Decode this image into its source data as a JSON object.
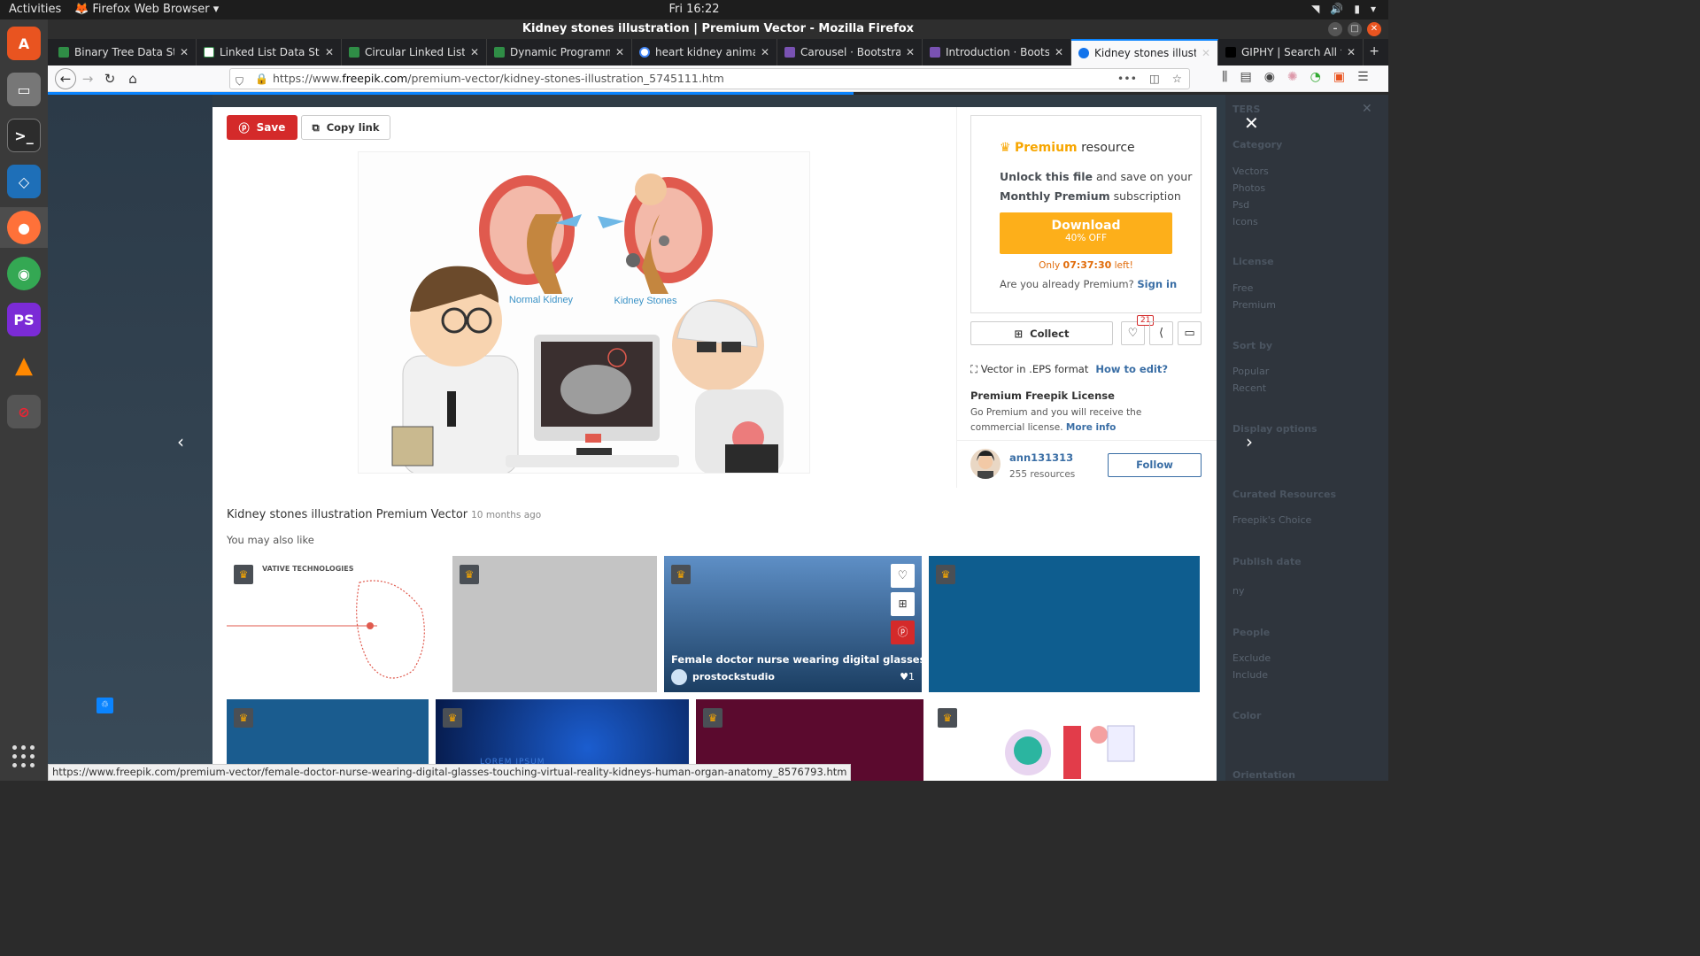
{
  "system": {
    "activities": "Activities",
    "app_menu": "Firefox Web Browser",
    "clock": "Fri 16:22"
  },
  "window": {
    "title": "Kidney stones illustration | Premium Vector - Mozilla Firefox"
  },
  "tabs": [
    {
      "label": "Binary Tree Data Stru"
    },
    {
      "label": "Linked List Data Struc"
    },
    {
      "label": "Circular Linked List | S"
    },
    {
      "label": "Dynamic Programmin"
    },
    {
      "label": "heart kidney animatio"
    },
    {
      "label": "Carousel · Bootstrap"
    },
    {
      "label": "Introduction · Bootst"
    },
    {
      "label": "Kidney stones illustra"
    },
    {
      "label": "GIPHY | Search All the"
    }
  ],
  "url": {
    "prefix": "https://www.",
    "domain": "freepik.com",
    "path": "/premium-vector/kidney-stones-illustration_5745111.htm"
  },
  "modal": {
    "save": "Save",
    "copy_link": "Copy link",
    "illustration": {
      "label_normal": "Normal Kidney",
      "label_stones": "Kidney Stones"
    },
    "premium": {
      "word": "Premium",
      "rest": " resource"
    },
    "unlock": {
      "b1": "Unlock this file",
      "t1": " and save on your ",
      "b2": "Monthly Premium",
      "t2": " subscription"
    },
    "download": {
      "label": "Download",
      "sub": "40% OFF"
    },
    "only": {
      "pre": "Only ",
      "time": "07:37:30",
      "post": " left!"
    },
    "already": {
      "text": "Are you already Premium? ",
      "link": "Sign in"
    },
    "collect": "Collect",
    "likes": "21",
    "format": {
      "text": "Vector in .EPS format",
      "link": "How to edit?"
    },
    "license": {
      "title": "Premium Freepik License",
      "text": "Go Premium and you will receive the commercial license. ",
      "link": "More info"
    },
    "author": {
      "name": "ann131313",
      "resources": "255 resources",
      "follow": "Follow"
    },
    "title": "Kidney stones illustration Premium Vector",
    "age": "10 months ago",
    "also": "You may also like",
    "related_hover": {
      "title": "Female doctor nurse wearing digital glasses touchin...",
      "author": "prostockstudio",
      "likes": "1"
    },
    "thumb1_text": "VATIVE  TECHNOLOGIES",
    "thumb6_text": "LOREM IPSUM"
  },
  "filters": {
    "header": "TERS",
    "category": "Category",
    "cat_items": [
      "Vectors",
      "Photos",
      "Psd",
      "Icons"
    ],
    "license": "License",
    "lic_items": [
      "Free",
      "Premium"
    ],
    "sort": "Sort by",
    "sort_items": [
      "Popular",
      "Recent"
    ],
    "display": "Display options",
    "curated": "Curated Resources",
    "curated_item": "Freepik's Choice",
    "publish": "Publish date",
    "publish_item": "ny",
    "people": "People",
    "people_items": [
      "Exclude",
      "Include"
    ],
    "color": "Color",
    "orientation": "Orientation"
  },
  "statusbar": "https://www.freepik.com/premium-vector/female-doctor-nurse-wearing-digital-glasses-touching-virtual-reality-kidneys-human-organ-anatomy_8576793.htm",
  "colors": {
    "accent": "#fdaf1a",
    "pinterest": "#d42a2a",
    "link": "#3a6ea5"
  }
}
